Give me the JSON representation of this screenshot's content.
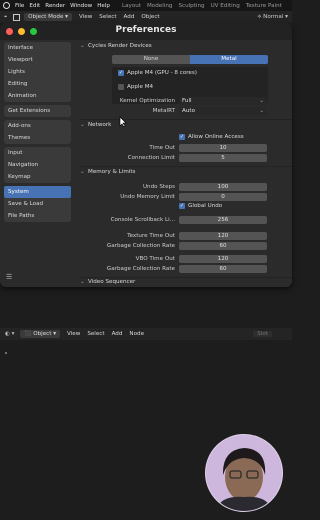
{
  "menubar": {
    "items": [
      "File",
      "Edit",
      "Render",
      "Window",
      "Help"
    ],
    "workspaces": [
      "Layout",
      "Modeling",
      "Sculpting",
      "UV Editing",
      "Texture Paint"
    ]
  },
  "editor_header": {
    "mode": "Object Mode",
    "menus": [
      "View",
      "Select",
      "Add",
      "Object"
    ],
    "transform": "Normal"
  },
  "prefs": {
    "title": "Preferences",
    "sidebar_groups": [
      [
        "Interface",
        "Viewport",
        "Lights",
        "Editing",
        "Animation"
      ],
      [
        "Get Extensions"
      ],
      [
        "Add-ons",
        "Themes"
      ],
      [
        "Input",
        "Navigation",
        "Keymap"
      ],
      [
        "System",
        "Save & Load",
        "File Paths"
      ]
    ],
    "active_item": "System",
    "cycles": {
      "header": "Cycles Render Devices",
      "tabs": [
        "None",
        "Metal"
      ],
      "active_tab": "Metal",
      "device1": "Apple M4 (GPU - 8 cores)",
      "device2": "Apple M4",
      "kernel_label": "Kernel Optimization",
      "kernel_value": "Full",
      "metalrt_label": "MetalRT",
      "metalrt_value": "Auto"
    },
    "network": {
      "header": "Network",
      "allow_online": "Allow Online Access",
      "timeout_label": "Time Out",
      "timeout_value": "10",
      "conn_label": "Connection Limit",
      "conn_value": "5"
    },
    "memory": {
      "header": "Memory & Limits",
      "undo_steps_label": "Undo Steps",
      "undo_steps_value": "100",
      "undo_mem_label": "Undo Memory Limit",
      "undo_mem_value": "0",
      "global_undo": "Global Undo",
      "console_label": "Console Scrollback Li...",
      "console_value": "256",
      "tex_timeout_label": "Texture Time Out",
      "tex_timeout_value": "120",
      "tex_gc_label": "Garbage Collection Rate",
      "tex_gc_value": "60",
      "vbo_timeout_label": "VBO Time Out",
      "vbo_timeout_value": "120",
      "vbo_gc_label": "Garbage Collection Rate",
      "vbo_gc_value": "60"
    },
    "video_seq": {
      "header": "Video Sequencer"
    }
  },
  "node_header": {
    "type": "Object",
    "menus": [
      "View",
      "Select",
      "Add",
      "Node"
    ],
    "slot": "Slot"
  },
  "colors": {
    "accent": "#4772b3",
    "traffic_red": "#ff5f57",
    "traffic_yellow": "#febc2e",
    "traffic_green": "#28c840"
  }
}
